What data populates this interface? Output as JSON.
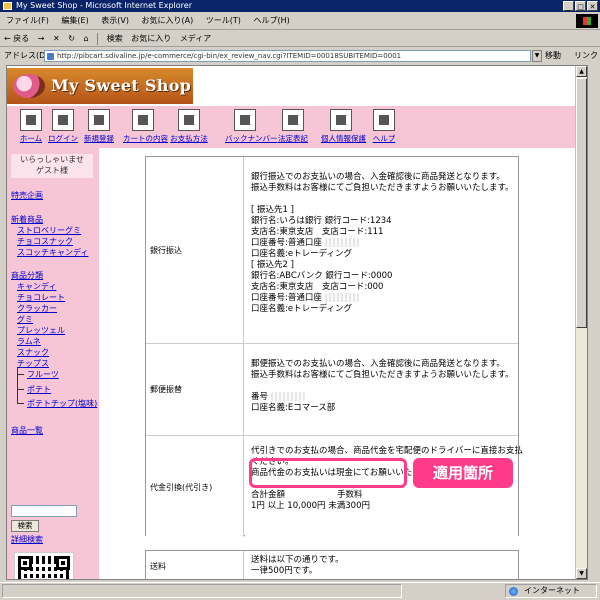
{
  "window": {
    "title": "My Sweet Shop - Microsoft Internet Explorer"
  },
  "menu": [
    "ファイル(F)",
    "編集(E)",
    "表示(V)",
    "お気に入り(A)",
    "ツール(T)",
    "ヘルプ(H)"
  ],
  "toolbar": {
    "back": "← 戻る",
    "forward": "→",
    "stop": "✕",
    "refresh": "↻",
    "home": "⌂",
    "search": "検索",
    "favorites": "お気に入り",
    "media": "メディア"
  },
  "address": {
    "label": "アドレス(D)",
    "url": "http://pibcart.sdivaline.jp/e-commerce/cgi-bin/ex_review_nav.cgi?ITEMID=00018SUBITEMID=0001",
    "go": "移動",
    "links": "リンク"
  },
  "header": {
    "logo_text": "My Sweet Shop"
  },
  "nav": [
    {
      "label": "ホーム",
      "icon": "home-icon"
    },
    {
      "label": "ログイン",
      "icon": "login-door-icon"
    },
    {
      "label": "新規登録",
      "icon": "pen-sign-icon"
    },
    {
      "label": "カートの内容",
      "icon": "cart-icon"
    },
    {
      "label": "お支払方法",
      "icon": "payment-icon"
    },
    {
      "label": "バックナンバー",
      "icon": "magazine-icon"
    },
    {
      "label": "法定表記",
      "icon": "document-icon"
    },
    {
      "label": "個人情報保護",
      "icon": "privacy-person-icon"
    },
    {
      "label": "ヘルプ",
      "icon": "question-icon"
    }
  ],
  "sidebar": {
    "welcome_line1": "いらっしゃいませ",
    "welcome_line2": "ゲスト様",
    "special": "特売企画",
    "new_products": "新着商品",
    "new_items": [
      "ストロベリーグミ",
      "チョコスナック",
      "スコッチキャンディ"
    ],
    "categories": "商品分類",
    "category_items": [
      "キャンディ",
      "チョコレート",
      "クラッカー",
      "グミ",
      "プレッツェル",
      "ラムネ",
      "スナック",
      "チップス"
    ],
    "chips_sub": [
      "フルーツ",
      "ポテト",
      "ポテトチップ(塩味)"
    ],
    "product_list": "商品一覧",
    "search_button": "検索",
    "advanced_search": "詳細検索"
  },
  "content": {
    "bank": {
      "label": "銀行振込",
      "intro1": "銀行振込でのお支払いの場合、入金確認後に商品発送となります。",
      "intro2": "振込手数料はお客様にてご負担いただきますようお願いいたします。",
      "acc1_header": "[ 振込先1 ]",
      "acc1_bank": "銀行名:いろは銀行 銀行コード:1234",
      "acc1_branch": "支店名:東京支店　支店コード:111",
      "acc1_number": "口座番号:普通口座",
      "acc1_name": "口座名義:eトレーディング",
      "acc2_header": "[ 振込先2 ]",
      "acc2_bank": "銀行名:ABCバンク 銀行コード:0000",
      "acc2_branch": "支店名:東京支店　支店コード:000",
      "acc2_number": "口座番号:普通口座",
      "acc2_name": "口座名義:eトレーディング"
    },
    "postal": {
      "label": "郵便振替",
      "intro1": "郵便振込でのお支払いの場合、入金確認後に商品発送となります。",
      "intro2": "振込手数料はお客様にてご負担いただきますようお願いいたします。",
      "number": "番号",
      "name": "口座名義:Eコマース部"
    },
    "cod": {
      "label": "代金引換(代引き)",
      "text1": "代引きでのお支払の場合、商品代金を宅配便のドライバーに直接お支払",
      "text2": "ください。",
      "text3": "商品代金のお支払いは現金にてお願いいたします。",
      "table_head_total": "合計金額",
      "table_head_fee": "手数料",
      "table_row": "1円 以上 10,000円 未満300円"
    },
    "shipping": {
      "label": "送料",
      "text1": "送料は以下の通りです。",
      "text2": "一律500円です。"
    }
  },
  "annotation": {
    "label": "適用箇所"
  },
  "status": {
    "zone": "インターネット"
  },
  "colors": {
    "pink_bg": "#f7c6d6",
    "highlight": "#ff3b8a",
    "link": "#0000cc"
  }
}
